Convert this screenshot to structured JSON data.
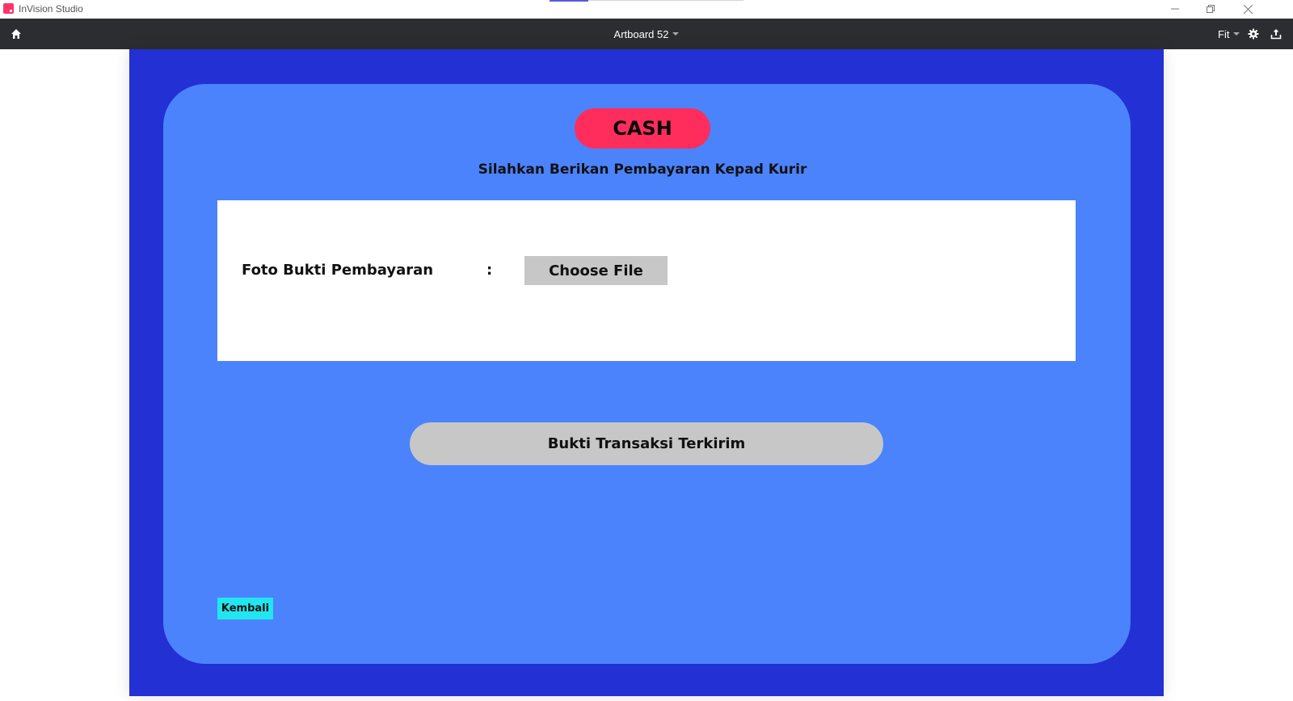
{
  "window": {
    "app_title": "InVision Studio",
    "icons": {
      "app_logo": "invision-logo-icon",
      "minimize": "minimize-icon",
      "restore": "restore-icon",
      "close": "close-icon"
    }
  },
  "toolbar": {
    "artboard_name": "Artboard 52",
    "zoom_label": "Fit",
    "icons": {
      "home": "home-icon",
      "settings": "gear-icon",
      "share": "share-upload-icon",
      "dropdown": "chevron-down-icon"
    }
  },
  "artboard": {
    "payment_method": "CASH",
    "instruction": "Silahkan Berikan Pembayaran Kepad Kurir",
    "upload": {
      "label": "Foto Bukti Pembayaran",
      "separator": ":",
      "button_label": "Choose File"
    },
    "submit_label": "Bukti Transaksi Terkirim",
    "back_label": "Kembali"
  },
  "colors": {
    "artboard_bg": "#2330d3",
    "panel_bg": "#4b83fd",
    "cash_badge": "#ff2d5c",
    "button_gray": "#c7c7c7",
    "back_button": "#22e6ef",
    "toolbar_bg": "#2c2d30"
  }
}
